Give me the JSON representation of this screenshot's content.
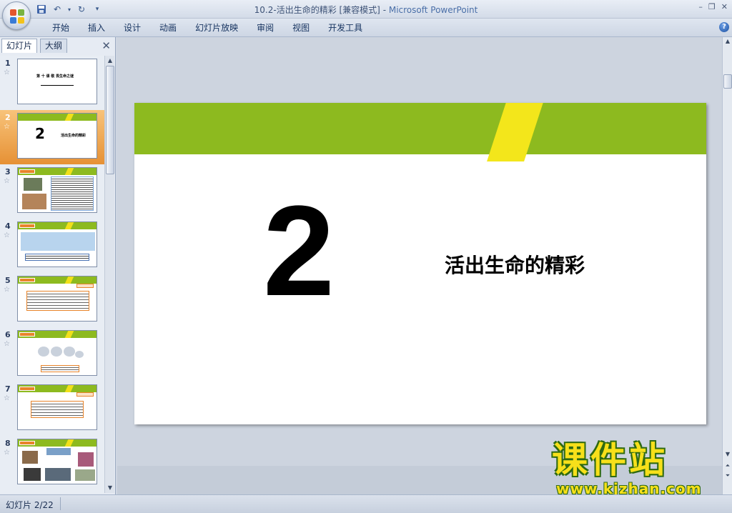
{
  "window": {
    "title_doc": "10.2-活出生命的精彩 [兼容模式]",
    "title_sep": " - ",
    "title_app": "Microsoft PowerPoint",
    "controls": [
      "–",
      "❐",
      "✕"
    ]
  },
  "ribbon": {
    "tabs": [
      "开始",
      "插入",
      "设计",
      "动画",
      "幻灯片放映",
      "审阅",
      "视图",
      "开发工具"
    ]
  },
  "left_pane": {
    "tabs": [
      "幻灯片",
      "大纲"
    ],
    "close": "✕",
    "thumbnails": [
      {
        "num": "1",
        "star": "☆"
      },
      {
        "num": "2",
        "star": "☆",
        "selected": true
      },
      {
        "num": "3",
        "star": "☆"
      },
      {
        "num": "4",
        "star": "☆"
      },
      {
        "num": "5",
        "star": "☆"
      },
      {
        "num": "6",
        "star": "☆"
      },
      {
        "num": "7",
        "star": "☆"
      },
      {
        "num": "8",
        "star": "☆"
      }
    ],
    "thumb1_text": "第 十 课 敬 畏生命之谜",
    "thumb2_num": "2",
    "thumb2_text": "活出生命的精彩"
  },
  "slide": {
    "number": "2",
    "title": "活出生命的精彩",
    "colors": {
      "banner": "#8dba1f",
      "stripe": "#f3e61b"
    }
  },
  "watermark": {
    "cn": "课件站",
    "url": "www.kjzhan.com"
  },
  "status": {
    "text": "幻灯片 2/22"
  }
}
